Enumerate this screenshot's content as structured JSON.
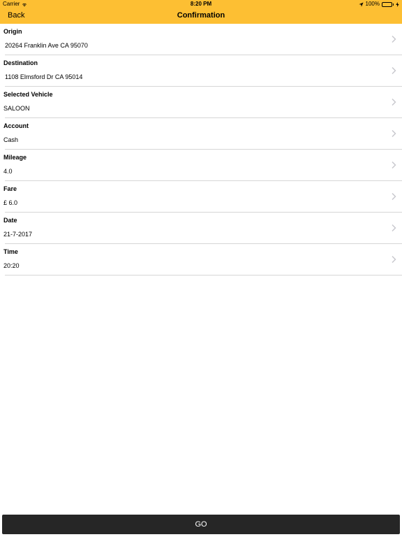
{
  "status_bar": {
    "carrier": "Carrier",
    "time": "8:20 PM",
    "battery": "100%"
  },
  "nav": {
    "back_label": "Back",
    "title": "Confirmation"
  },
  "rows": [
    {
      "label": "Origin",
      "value": "20264 Franklin Ave CA 95070"
    },
    {
      "label": "Destination",
      "value": "1108 Elmsford Dr CA 95014"
    },
    {
      "label": "Selected Vehicle",
      "value": "SALOON"
    },
    {
      "label": "Account",
      "value": "Cash"
    },
    {
      "label": "Mileage",
      "value": "4.0"
    },
    {
      "label": "Fare",
      "value": "£ 6.0"
    },
    {
      "label": "Date",
      "value": "21-7-2017"
    },
    {
      "label": "Time",
      "value": "20:20"
    }
  ],
  "go_label": "GO",
  "colors": {
    "header": "#fdbf33",
    "button": "#262626",
    "battery": "#4cd964"
  }
}
